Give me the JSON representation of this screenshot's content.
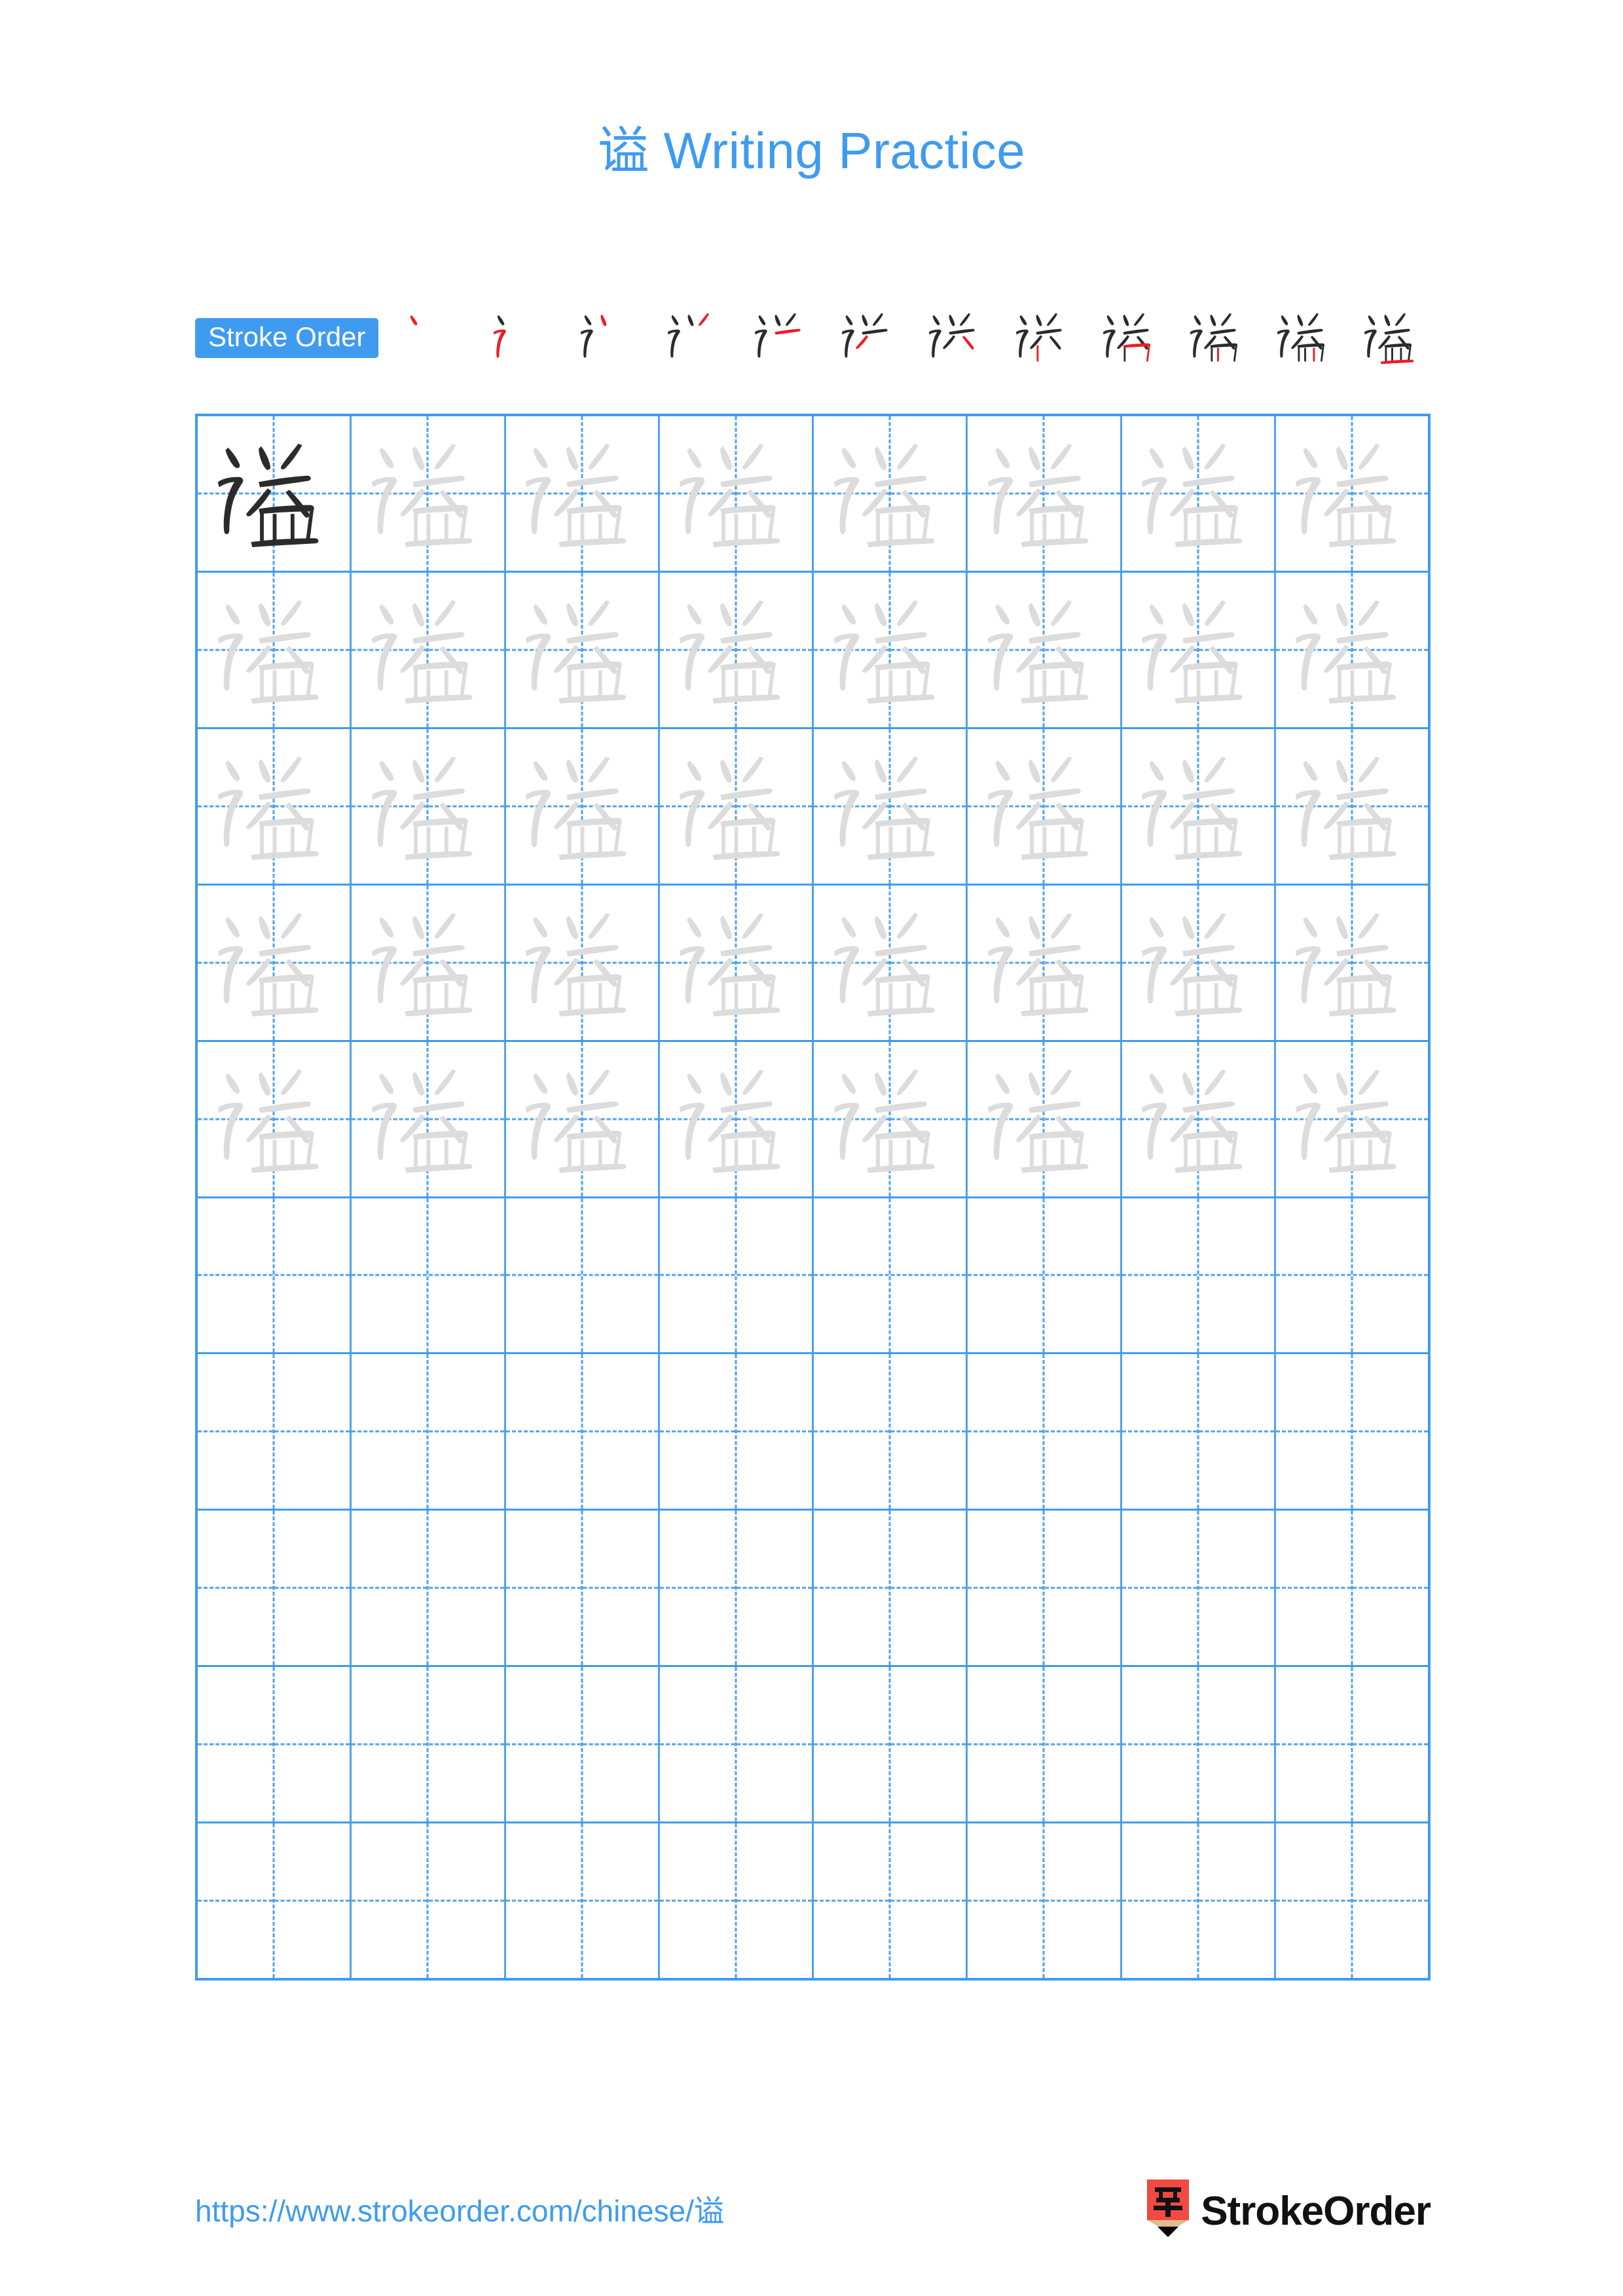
{
  "page": {
    "character": "谥",
    "title_suffix": " Writing Practice",
    "title_full": "谥 Writing Practice",
    "accent_color": "#3f9bef",
    "grid_line_color": "#4da2f0",
    "trace_gray_color": "#dcdcdc",
    "ink_color": "#2b2b2b",
    "highlight_stroke_color": "#ee1c25"
  },
  "stroke_order": {
    "badge_label": "Stroke Order",
    "total_strokes": 12,
    "steps": [
      {
        "index": 1,
        "new_stroke": "dian (dot)",
        "strokes_shown": 1
      },
      {
        "index": 2,
        "new_stroke": "hengzhe-tiao",
        "strokes_shown": 2
      },
      {
        "index": 3,
        "new_stroke": "dian",
        "strokes_shown": 3
      },
      {
        "index": 4,
        "new_stroke": "pie",
        "strokes_shown": 4
      },
      {
        "index": 5,
        "new_stroke": "heng",
        "strokes_shown": 5
      },
      {
        "index": 6,
        "new_stroke": "pie",
        "strokes_shown": 6
      },
      {
        "index": 7,
        "new_stroke": "na",
        "strokes_shown": 7
      },
      {
        "index": 8,
        "new_stroke": "shu",
        "strokes_shown": 8
      },
      {
        "index": 9,
        "new_stroke": "hengzhe",
        "strokes_shown": 9
      },
      {
        "index": 10,
        "new_stroke": "shu",
        "strokes_shown": 10
      },
      {
        "index": 11,
        "new_stroke": "shu",
        "strokes_shown": 11
      },
      {
        "index": 12,
        "new_stroke": "heng",
        "strokes_shown": 12
      }
    ]
  },
  "practice_grid": {
    "columns": 8,
    "rows": 10,
    "filled_rows": 5,
    "blank_rows": 5,
    "row_cells": [
      [
        "ink",
        "trace",
        "trace",
        "trace",
        "trace",
        "trace",
        "trace",
        "trace"
      ],
      [
        "trace",
        "trace",
        "trace",
        "trace",
        "trace",
        "trace",
        "trace",
        "trace"
      ],
      [
        "trace",
        "trace",
        "trace",
        "trace",
        "trace",
        "trace",
        "trace",
        "trace"
      ],
      [
        "trace",
        "trace",
        "trace",
        "trace",
        "trace",
        "trace",
        "trace",
        "trace"
      ],
      [
        "trace",
        "trace",
        "trace",
        "trace",
        "trace",
        "trace",
        "trace",
        "trace"
      ],
      [
        "empty",
        "empty",
        "empty",
        "empty",
        "empty",
        "empty",
        "empty",
        "empty"
      ],
      [
        "empty",
        "empty",
        "empty",
        "empty",
        "empty",
        "empty",
        "empty",
        "empty"
      ],
      [
        "empty",
        "empty",
        "empty",
        "empty",
        "empty",
        "empty",
        "empty",
        "empty"
      ],
      [
        "empty",
        "empty",
        "empty",
        "empty",
        "empty",
        "empty",
        "empty",
        "empty"
      ],
      [
        "empty",
        "empty",
        "empty",
        "empty",
        "empty",
        "empty",
        "empty",
        "empty"
      ]
    ]
  },
  "footer": {
    "url": "https://www.strokeorder.com/chinese/谥",
    "brand_name": "StrokeOrder",
    "brand_logo_character": "字",
    "brand_logo_body_color": "#f04a43",
    "brand_logo_wood_color": "#e2bb8e",
    "brand_logo_tip_color": "#000000"
  }
}
